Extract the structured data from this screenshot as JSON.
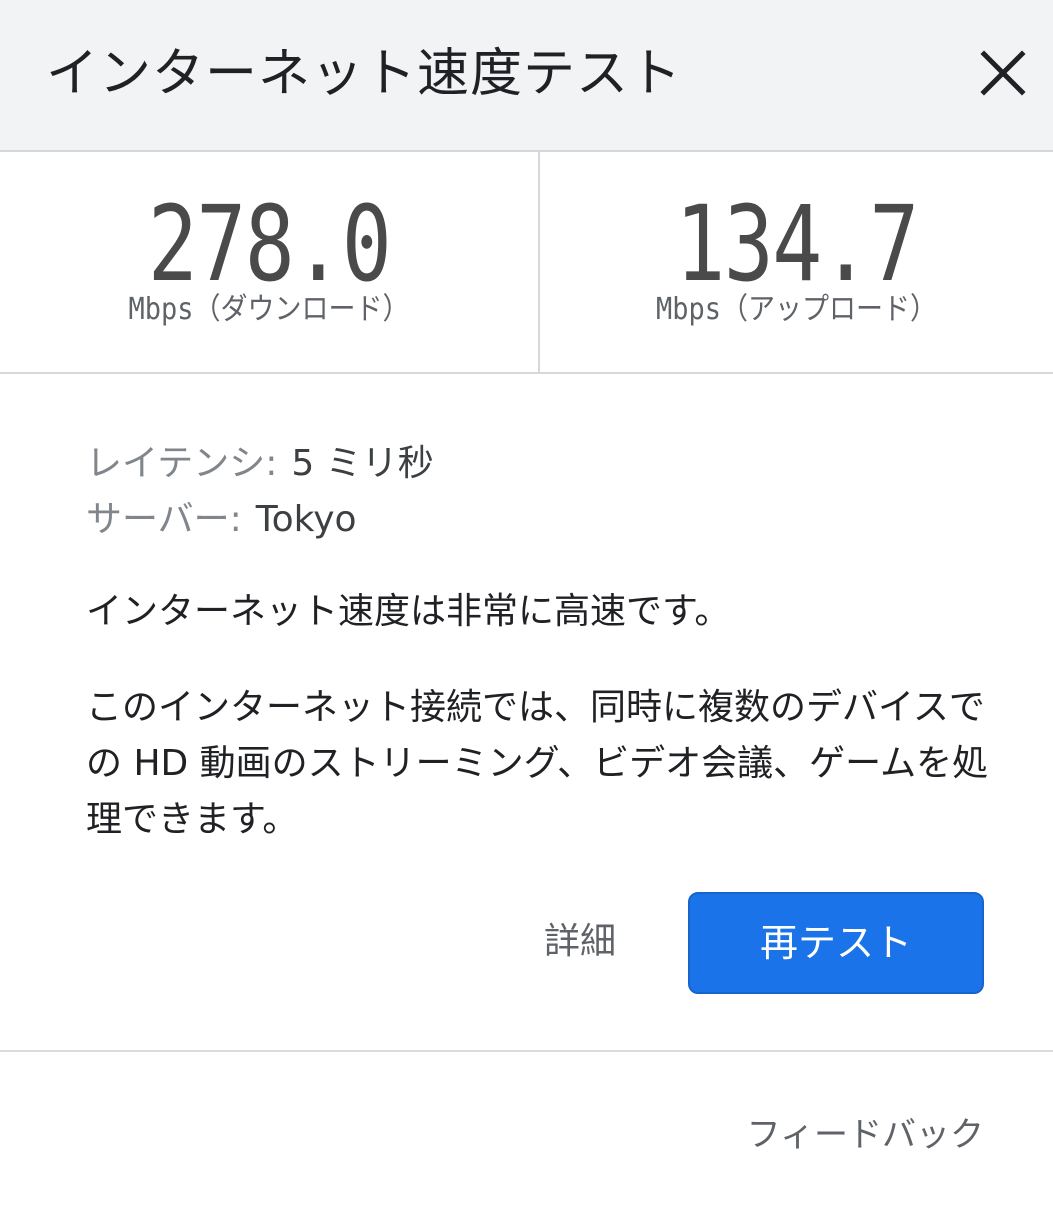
{
  "dialog": {
    "title": "インターネット速度テスト",
    "close_icon": "close-icon"
  },
  "results": {
    "download": {
      "value": "278.0",
      "unit": "Mbps（ダウンロード）"
    },
    "upload": {
      "value": "134.7",
      "unit": "Mbps（アップロード）"
    }
  },
  "info": {
    "latency_label": "レイテンシ:",
    "latency_value": "5 ミリ秒",
    "server_label": "サーバー:",
    "server_value": "Tokyo"
  },
  "summary": "インターネット速度は非常に高速です。",
  "description": "このインターネット接続では、同時に複数のデバイスでの HD 動画のストリーミング、ビデオ会議、ゲームを処理できます。",
  "actions": {
    "details_label": "詳細",
    "retest_label": "再テスト"
  },
  "footer": {
    "feedback_label": "フィードバック"
  },
  "colors": {
    "header_bg": "#f1f3f4",
    "accent": "#1a73e8",
    "divider": "#d5d7d9"
  }
}
